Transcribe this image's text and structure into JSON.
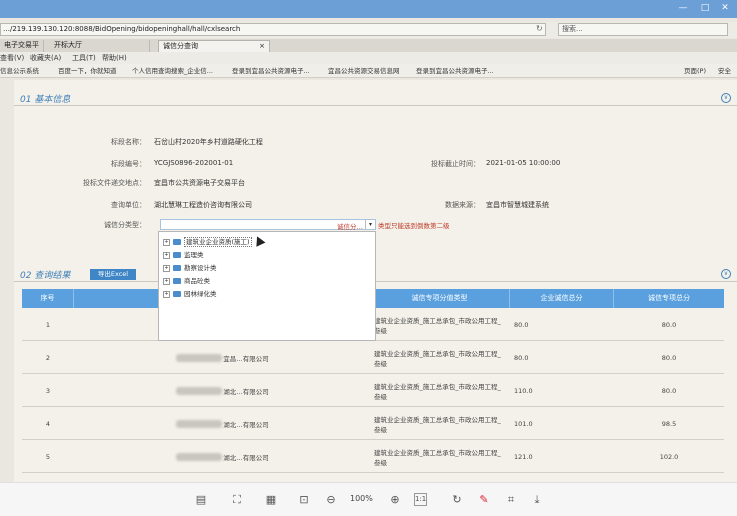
{
  "titlebar": {
    "minimize": "—",
    "maximize": "□",
    "close": "✕"
  },
  "browser": {
    "url": "…/219.139.130.120:8088/BidOpening/bidopeninghall/hall/cxlsearch",
    "search_placeholder": "搜索...",
    "tabs": [
      "电子交易平台",
      "开标大厅",
      "诚信分查询"
    ],
    "menu": [
      "查看(V)",
      "收藏夹(A)",
      "工具(T)",
      "帮助(H)"
    ],
    "favorites": [
      "信息公示系统",
      "百度一下，你就知道",
      "个人信用查询搜索_企业信...",
      "登录到宜昌公共资源电子...",
      "宜昌公共资源交易信息网",
      "登录到宜昌公共资源电子..."
    ],
    "page_menu": "页面(P)",
    "safety_menu": "安全"
  },
  "basic": {
    "title": "01 基本信息",
    "toggle": "∨",
    "fields": {
      "section_name_label": "标段名称：",
      "section_name": "石岔山村2020年乡村道路硬化工程",
      "section_no_label": "标段编号：",
      "section_no": "YCGJS0896-202001-01",
      "deadline_label": "投标截止时间：",
      "deadline": "2021-01-05 10:00:00",
      "submit_place_label": "投标文件递交地点：",
      "submit_place": "宜昌市公共资源电子交易平台",
      "query_unit_label": "查询单位：",
      "query_unit": "湖北慧琳工程造价咨询有限公司",
      "source_label": "数据来源：",
      "source": "宜昌市智慧城建系统",
      "type_label": "诚信分类型："
    },
    "select_value": "诚信分…",
    "hint": "类型只能选到倒数第二级",
    "tree": [
      "建筑业企业资质(施工)",
      "监理类",
      "勘察设计类",
      "商品砼类",
      "园林绿化类"
    ]
  },
  "result": {
    "title": "02 查询结果",
    "export": "导出Excel",
    "toggle": "∨",
    "columns": [
      "序号",
      "企业名称",
      "诚信专项分值类型",
      "企业诚信总分",
      "诚信专项总分"
    ],
    "rows": [
      {
        "no": "1",
        "company": "…有限公司",
        "type": "建筑业企业资质_施工总承包_市政公用工程_叁级",
        "total": "80.0",
        "special": "80.0"
      },
      {
        "no": "2",
        "company": "宜昌…有限公司",
        "type": "建筑业企业资质_施工总承包_市政公用工程_叁级",
        "total": "80.0",
        "special": "80.0"
      },
      {
        "no": "3",
        "company": "湖北…有限公司",
        "type": "建筑业企业资质_施工总承包_市政公用工程_叁级",
        "total": "110.0",
        "special": "80.0"
      },
      {
        "no": "4",
        "company": "湖北…有限公司",
        "type": "建筑业企业资质_施工总承包_市政公用工程_叁级",
        "total": "101.0",
        "special": "98.5"
      },
      {
        "no": "5",
        "company": "湖北…有限公司",
        "type": "建筑业企业资质_施工总承包_市政公用工程_叁级",
        "total": "121.0",
        "special": "102.0"
      },
      {
        "no": "",
        "company": "湖北…",
        "type": "建筑业企业资质_施工总承包_市政公用工程_叁",
        "total": "",
        "special": ""
      }
    ]
  },
  "viewer": {
    "zoom": "100%",
    "ratio": "1:1"
  }
}
